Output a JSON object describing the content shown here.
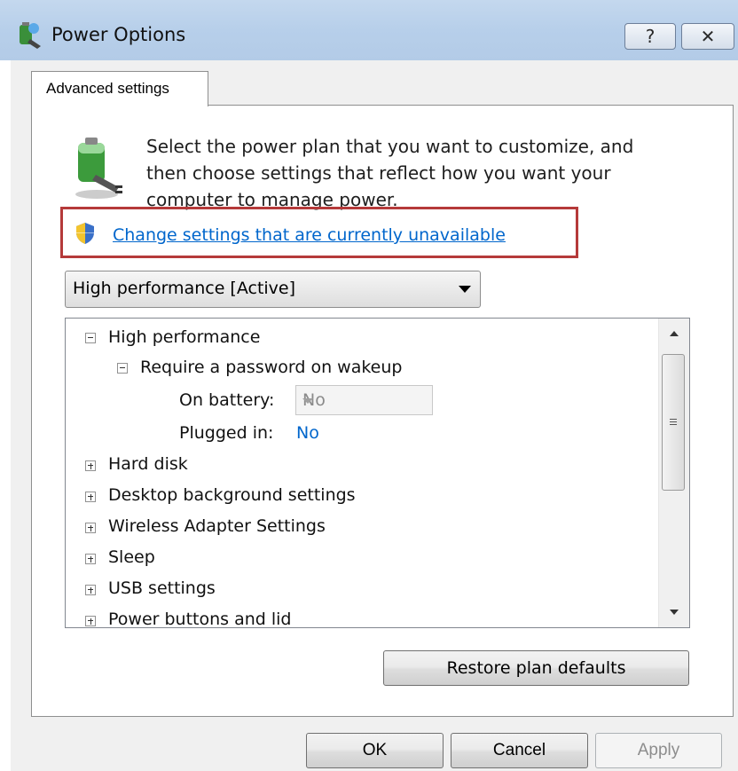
{
  "window": {
    "title": "Power Options",
    "help_glyph": "?",
    "close_glyph": "✕"
  },
  "tab": {
    "label": "Advanced settings"
  },
  "intro": {
    "text": "Select the power plan that you want to customize, and then choose settings that reflect how you want your computer to manage power."
  },
  "change_link": {
    "label": "Change settings that are currently unavailable"
  },
  "plan_select": {
    "value": "High performance [Active]"
  },
  "tree": {
    "plan": "High performance",
    "password_group": "Require a password on wakeup",
    "on_battery_label": "On battery:",
    "on_battery_value": "No",
    "plugged_in_label": "Plugged in:",
    "plugged_in_value": "No",
    "items": [
      "Hard disk",
      "Desktop background settings",
      "Wireless Adapter Settings",
      "Sleep",
      "USB settings",
      "Power buttons and lid"
    ]
  },
  "buttons": {
    "restore": "Restore plan defaults",
    "ok": "OK",
    "cancel": "Cancel",
    "apply": "Apply"
  },
  "colors": {
    "highlight": "#b53a3a",
    "link": "#0066cc"
  }
}
